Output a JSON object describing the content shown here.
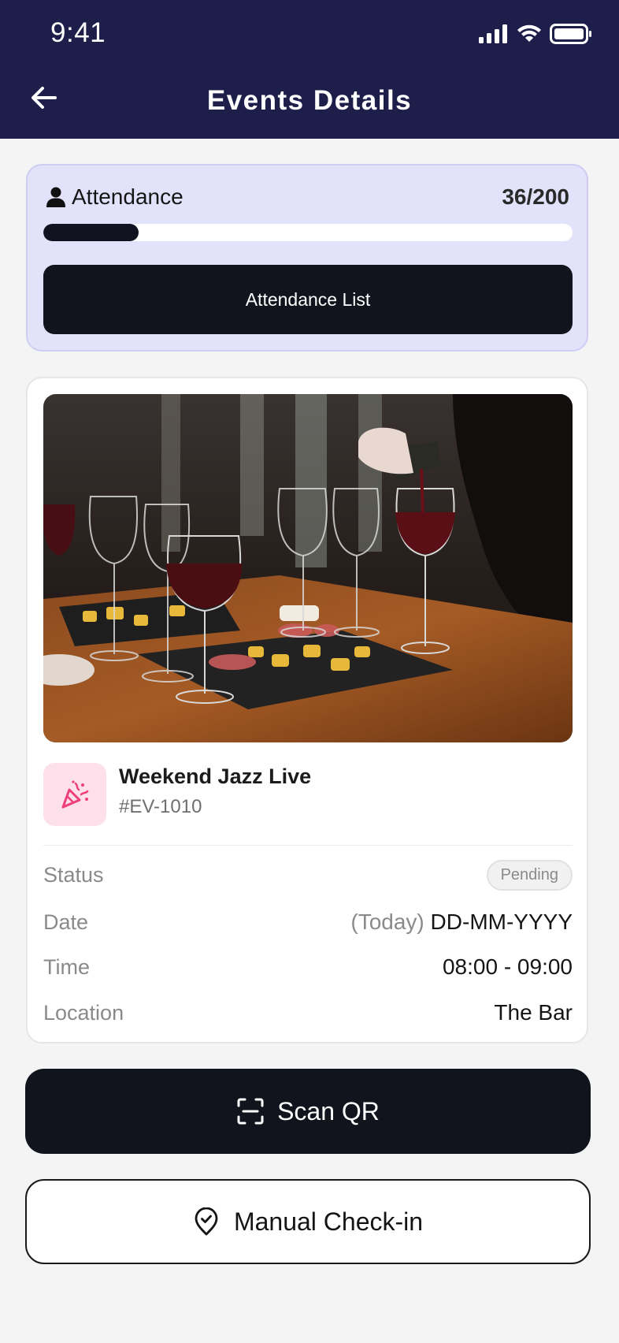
{
  "status_bar": {
    "time": "9:41"
  },
  "header": {
    "title": "Events Details"
  },
  "attendance": {
    "label": "Attendance",
    "count": "36/200",
    "progress_fraction": 0.18,
    "list_button_label": "Attendance List"
  },
  "event": {
    "name": "Weekend Jazz Live",
    "id": "#EV-1010",
    "icon": "party-popper-icon",
    "details": {
      "status_label": "Status",
      "status_value": "Pending",
      "date_label": "Date",
      "date_prefix": "(Today)",
      "date_value": "DD-MM-YYYY",
      "time_label": "Time",
      "time_value": "08:00 - 09:00",
      "location_label": "Location",
      "location_value": "The Bar"
    }
  },
  "actions": {
    "scan_label": "Scan QR",
    "manual_label": "Manual Check-in"
  },
  "colors": {
    "header_bg": "#1e1e4b",
    "attendance_card_bg": "#e3e2fb",
    "primary_button": "#11141d",
    "event_icon_bg": "#fde0ea",
    "event_icon_fg": "#ef3f7a"
  }
}
